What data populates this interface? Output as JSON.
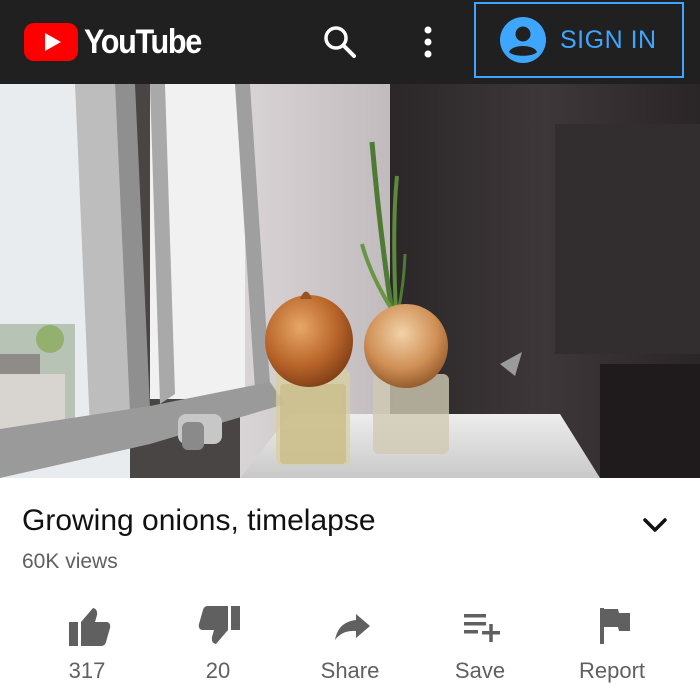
{
  "header": {
    "logo_text": "YouTube",
    "search_icon": "search-icon",
    "more_icon": "more-vert-icon",
    "signin_label": "SIGN IN",
    "signin_icon": "account-circle-icon",
    "colors": {
      "bar": "#202020",
      "brand_red": "#ff0000",
      "signin_blue": "#3ea6ff"
    }
  },
  "video": {
    "title": "Growing onions, timelapse",
    "views": "60K views"
  },
  "actions": [
    {
      "icon": "thumbs-up-icon",
      "label": "317"
    },
    {
      "icon": "thumbs-down-icon",
      "label": "20"
    },
    {
      "icon": "share-icon",
      "label": "Share"
    },
    {
      "icon": "playlist-add-icon",
      "label": "Save"
    },
    {
      "icon": "flag-icon",
      "label": "Report"
    }
  ]
}
